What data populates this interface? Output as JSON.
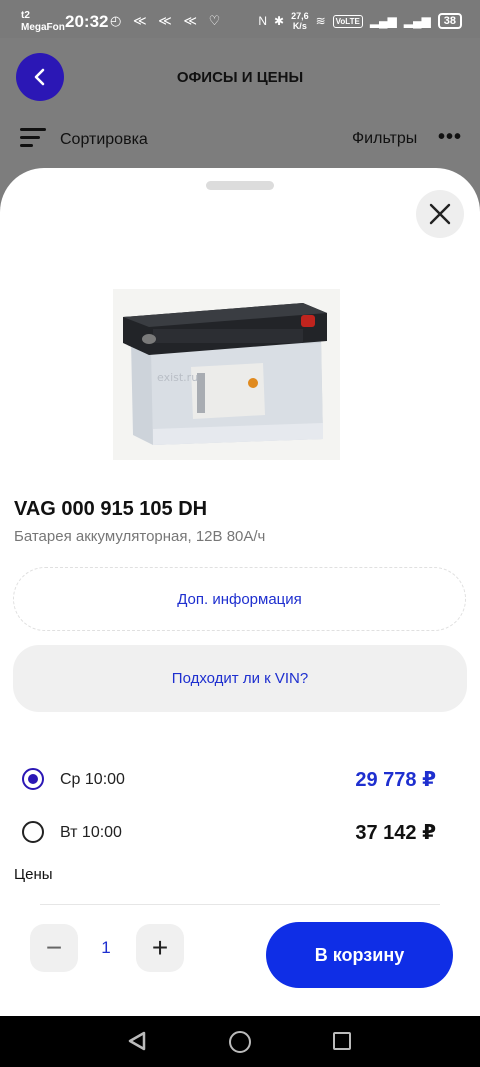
{
  "status_bar": {
    "carrier_line1": "t2",
    "carrier_line2": "MegaFon",
    "time": "20:32",
    "net_speed_value": "27,6",
    "net_speed_unit": "K/s",
    "volte": "VoLTE",
    "battery": "38"
  },
  "header": {
    "title": "ОФИСЫ И ЦЕНЫ",
    "sort_label": "Сортировка",
    "filters_label": "Фильтры",
    "more_icon": "more-icon"
  },
  "product": {
    "title": "VAG 000 915 105 DH",
    "subtitle": "Батарея аккумуляторная, 12В 80А/ч",
    "watermark": "exist.ru"
  },
  "buttons": {
    "more_info": "Доп. информация",
    "vin_check": "Подходит ли к VIN?",
    "add_to_cart": "В корзину"
  },
  "offers": [
    {
      "date": "Ср 10:00",
      "price": "29 778 ₽",
      "selected": true
    },
    {
      "date": "Вт 10:00",
      "price": "37 142 ₽",
      "selected": false
    }
  ],
  "prices_label": "Цены",
  "quantity": {
    "value": "1",
    "minus": "−",
    "plus": "+"
  },
  "colors": {
    "accent": "#2b17b5",
    "link_blue": "#1e2fcf",
    "cart_button": "#0f2ee6"
  }
}
